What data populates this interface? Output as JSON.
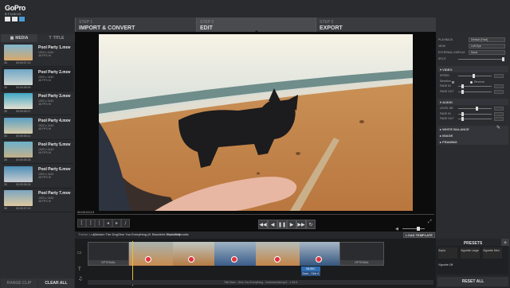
{
  "app": {
    "logo_main": "GoPro",
    "logo_sub": "STUDIO"
  },
  "steps": [
    {
      "num": "STEP 1",
      "title": "IMPORT & CONVERT"
    },
    {
      "num": "STEP 2",
      "title": "EDIT"
    },
    {
      "num": "STEP 3",
      "title": "EXPORT"
    }
  ],
  "media": {
    "tabs": [
      "MEDIA",
      "TITLE"
    ],
    "clips": [
      {
        "name": "Pool Party 1.mov",
        "info": "1920 x 1440\n48 FPS Hi",
        "fps": "30",
        "dur": "00:00:07:13"
      },
      {
        "name": "Pool Party 2.mov",
        "info": "1920 x 1440\n48 FPS Hi",
        "fps": "30",
        "dur": "00:00:05:00"
      },
      {
        "name": "Pool Party 3.mov",
        "info": "1920 x 1440\n48 FPS Hi",
        "fps": "30",
        "dur": "00:00:05:17"
      },
      {
        "name": "Pool Party 4.mov",
        "info": "1920 x 1440\n48 FPS Hi",
        "fps": "30",
        "dur": "00:00:06:11"
      },
      {
        "name": "Pool Party 5.mov",
        "info": "1920 x 1440\n48 FPS Hi",
        "fps": "30",
        "dur": "00:00:05:26"
      },
      {
        "name": "Pool Party 6.mov",
        "info": "1920 x 1440\n48 FPS Hi",
        "fps": "30",
        "dur": "00:00:06:24"
      },
      {
        "name": "Pool Party 7.mov",
        "info": "1920 x 1440\n48 FPS Hi",
        "fps": "30",
        "dur": "00:00:07:19"
      }
    ],
    "bottom_buttons": [
      "RANGE CLIP",
      "CLEAR ALL"
    ]
  },
  "preview": {
    "timecode": "00:00:03:13"
  },
  "right": {
    "rows": [
      {
        "label": "PLAYBACK",
        "value": "Default (Fast)"
      },
      {
        "label": "VIEW",
        "value": "Left Eye"
      },
      {
        "label": "EXTERNAL DISPLAY",
        "value": "None"
      },
      {
        "label": "SPLIT",
        "value": ""
      }
    ],
    "sections": [
      "VIDEO",
      "AUDIO",
      "WHITE BALANCE",
      "IMAGE",
      "FRAMING"
    ],
    "video_sliders": [
      "SPEED",
      "Direction",
      "FADE IN",
      "FADE OUT"
    ],
    "direction_option": "Reverse",
    "audio_sliders": [
      "LEVEL DB",
      "FADE IN",
      "FADE OUT"
    ]
  },
  "timeline": {
    "theme_label": "Theme Loop",
    "theme_value": "Chicken The Dog",
    "song_value": "Give You Everything (ft. Blackbird Blackbird)",
    "style_label": "Style",
    "style_value": "Cinematic",
    "load_template": "LOAD TEMPLATE",
    "slot_label": "OPTIONAL",
    "music_tag": "MUSIC",
    "music_sub": "Bass - Side A",
    "bottom_text": "Title Bars - Give You Everything - Instrumental.mp3 - 1:39.6"
  },
  "presets": {
    "title": "PRESETS",
    "items": [
      "Sepia",
      "Vignette Large",
      "Vignette Med",
      "Vignette Off"
    ],
    "reset": "RESET ALL"
  }
}
